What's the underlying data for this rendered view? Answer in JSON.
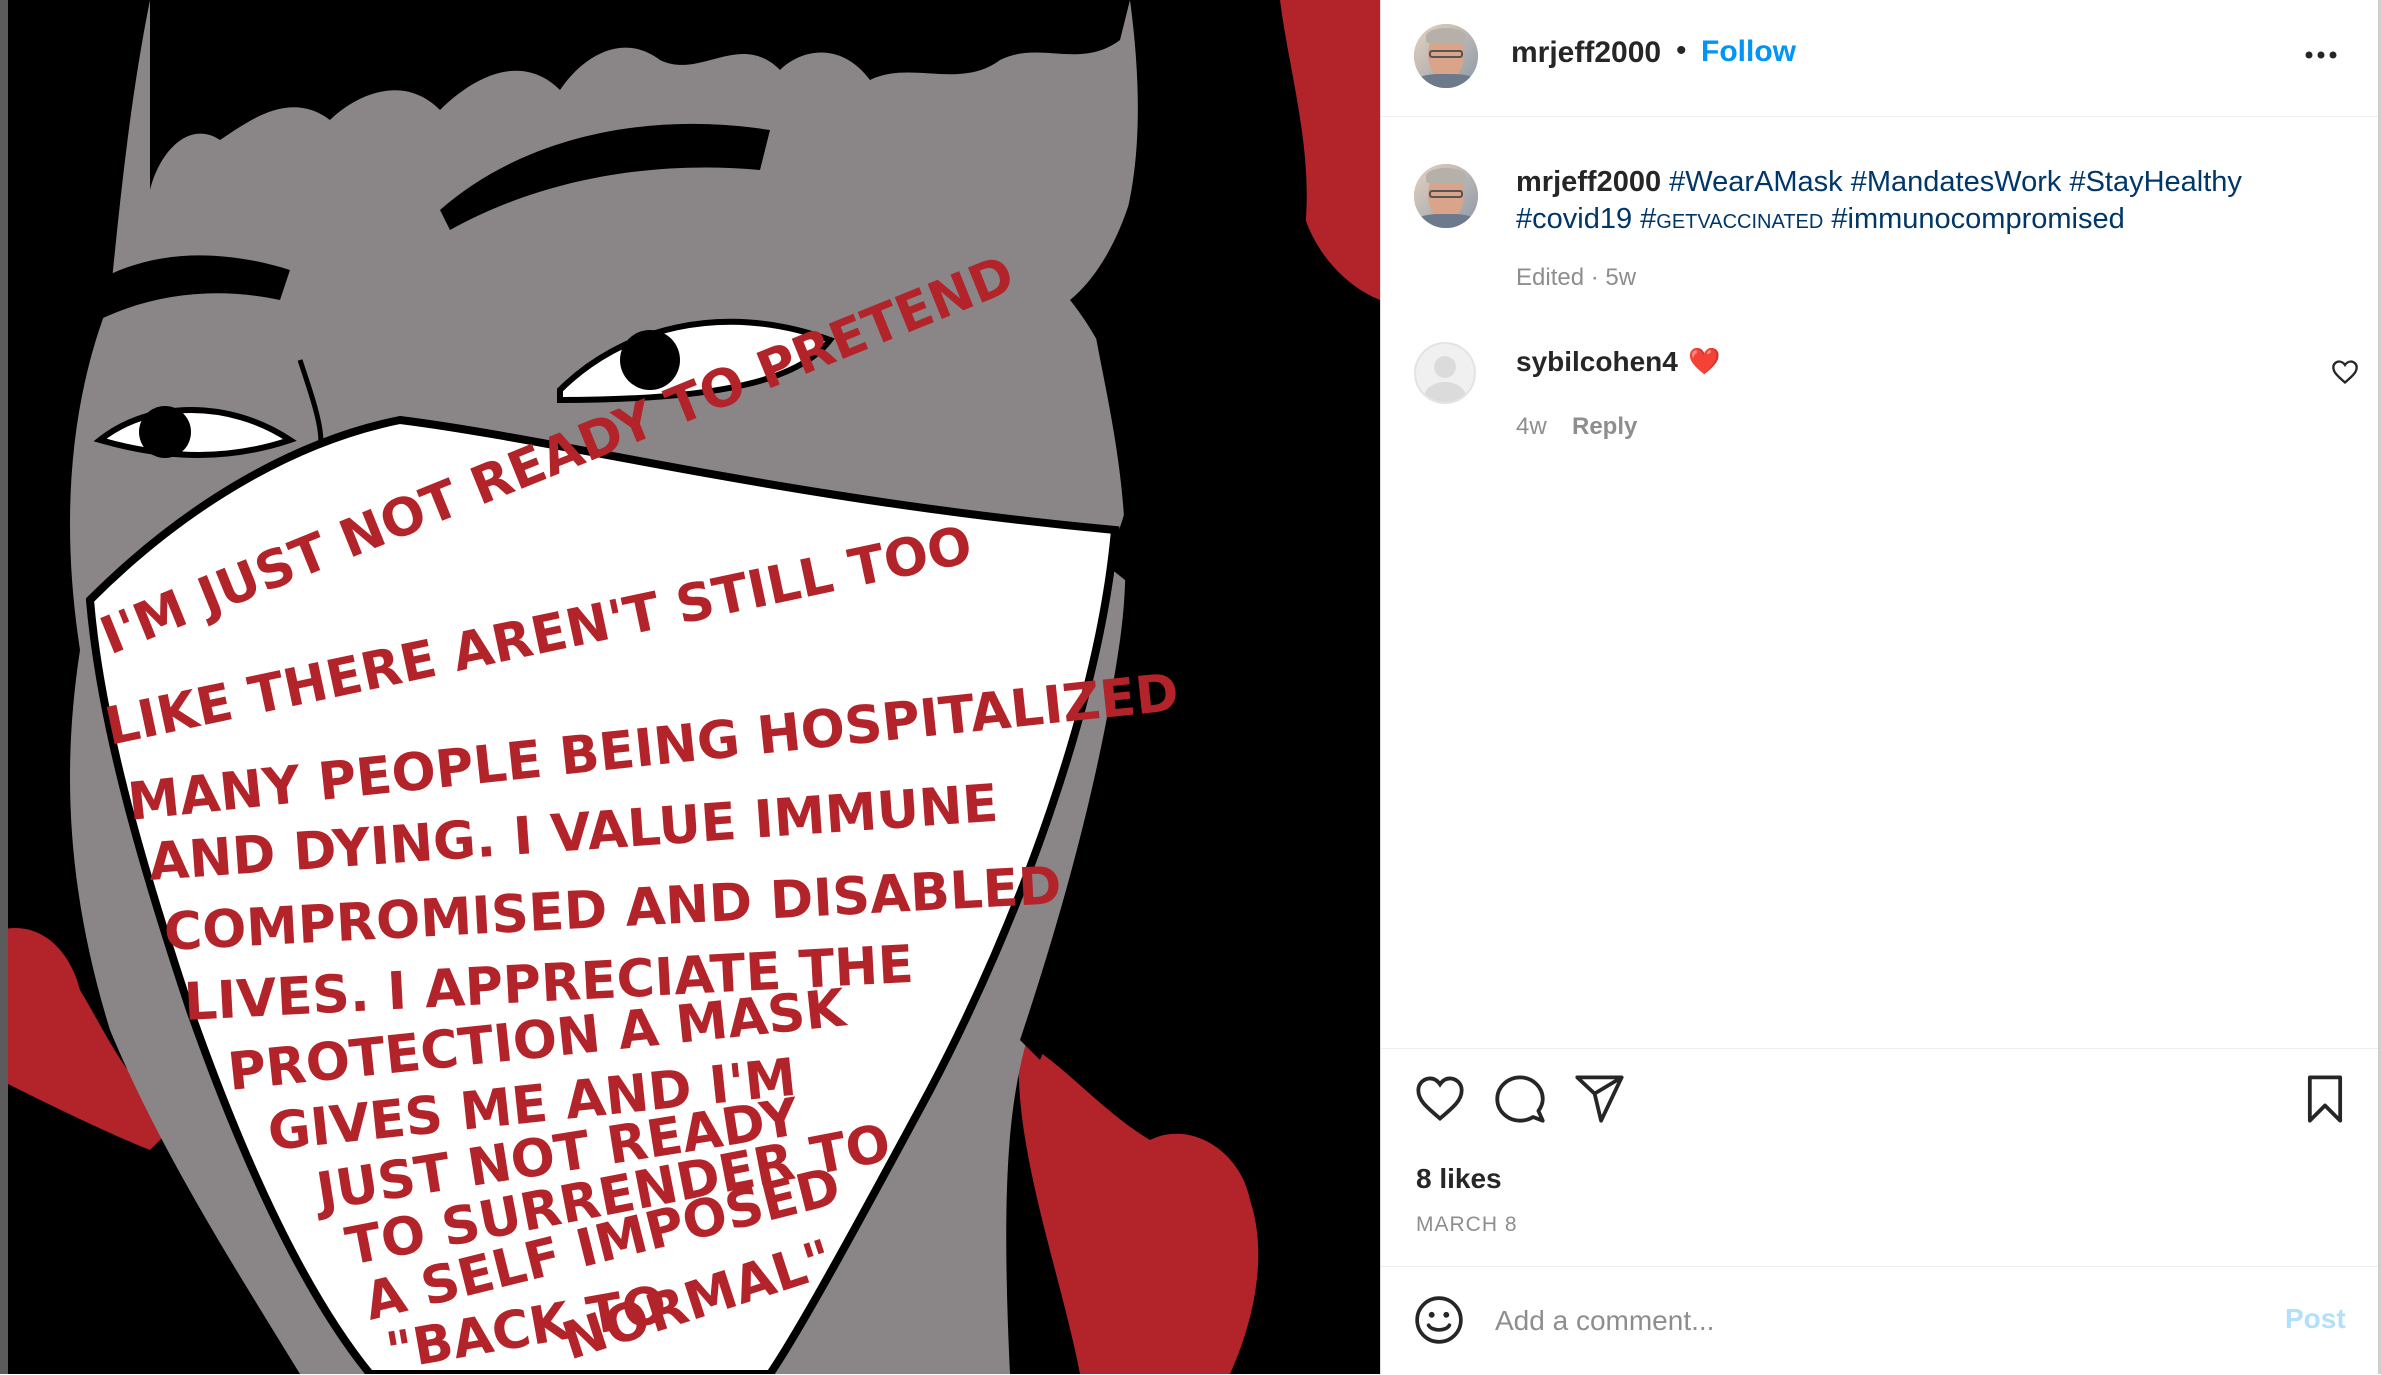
{
  "image": {
    "alt_text_lines": [
      "I'M JUST NOT READY TO PRETEND",
      "LIKE THERE AREN'T STILL TOO",
      "MANY PEOPLE BEING HOSPITALIZED",
      "AND DYING. I VALUE IMMUNE",
      "COMPROMISED AND DISABLED",
      "LIVES. I APPRECIATE THE",
      "PROTECTION A MASK",
      "GIVES ME AND I'M",
      "JUST NOT READY",
      "TO SURRENDER TO",
      "A SELF IMPOSED",
      "\"BACK TO",
      "NORMAL\""
    ],
    "colors": {
      "background": "#000000",
      "skin": "#8a8688",
      "mask": "#ffffff",
      "text": "#b3242a",
      "accent": "#b3242a"
    }
  },
  "header": {
    "username": "mrjeff2000",
    "dot": "•",
    "follow_label": "Follow",
    "more_icon": "more-horizontal-icon"
  },
  "caption": {
    "username": "mrjeff2000",
    "tags": [
      "#WearAMask",
      "#MandatesWork",
      "#StayHealthy",
      "#covid19",
      "#getvaccinated",
      "#immunocompromised"
    ],
    "meta": "Edited · 5w"
  },
  "comments": [
    {
      "username": "sybilcohen4",
      "text": "❤️",
      "age": "4w",
      "reply_label": "Reply"
    }
  ],
  "actions": {
    "icons": [
      "heart-icon",
      "comment-icon",
      "share-icon",
      "bookmark-icon"
    ],
    "likes": "8 likes",
    "date": "MARCH 8"
  },
  "comment_box": {
    "placeholder": "Add a comment...",
    "post_label": "Post"
  },
  "colors": {
    "link": "#0095f6",
    "hashtag": "#00376b",
    "muted": "#8e8e8e",
    "post_disabled": "#b2dffc"
  }
}
